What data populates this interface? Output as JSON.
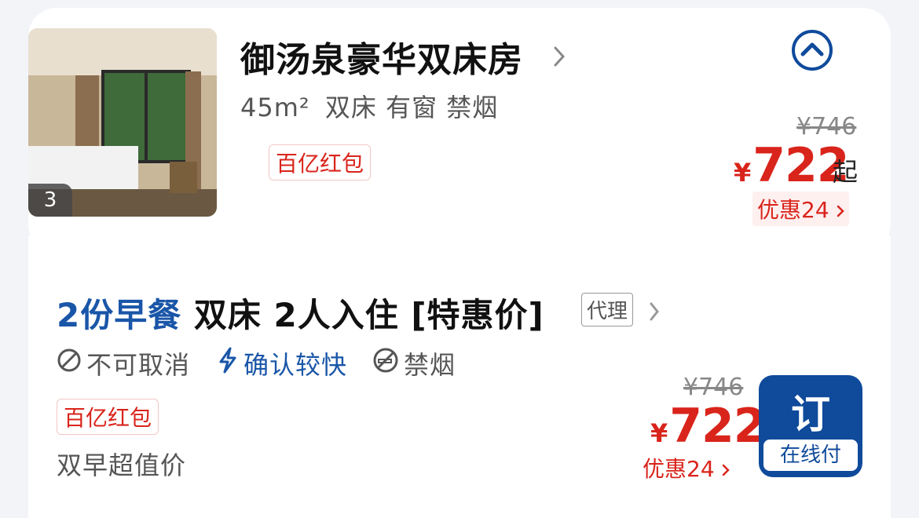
{
  "room": {
    "photo_count": "3",
    "title": "御汤泉豪华双床房",
    "specs_area": "45",
    "specs_unit": "m²",
    "specs_rest": "双床 有窗 禁烟",
    "promo_badge": "百亿红包",
    "price_original": "¥746",
    "price_currency": "¥",
    "price_current": "722",
    "price_suffix": "起",
    "discount": "优惠24"
  },
  "plan": {
    "breakfast": "2份早餐",
    "title_rest": "双床 2人入住 [特惠价]",
    "agent_tag": "代理",
    "features": [
      "不可取消",
      "确认较快",
      "禁烟"
    ],
    "promo_badge": "百亿红包",
    "subtext": "双早超值价",
    "price_original": "¥746",
    "price_currency": "¥",
    "price_current": "722",
    "discount": "优惠24",
    "book_label": "订",
    "pay_label": "在线付"
  },
  "icons": {
    "collapse": "chevron-up-circle-icon",
    "chevron": "chevron-right-icon",
    "no_cancel": "prohibited-icon",
    "fast_confirm": "lightning-icon",
    "no_smoking": "no-smoking-icon"
  },
  "colors": {
    "accent_blue": "#0f4a9b",
    "price_red": "#d9241b",
    "text_gray": "#555555"
  }
}
